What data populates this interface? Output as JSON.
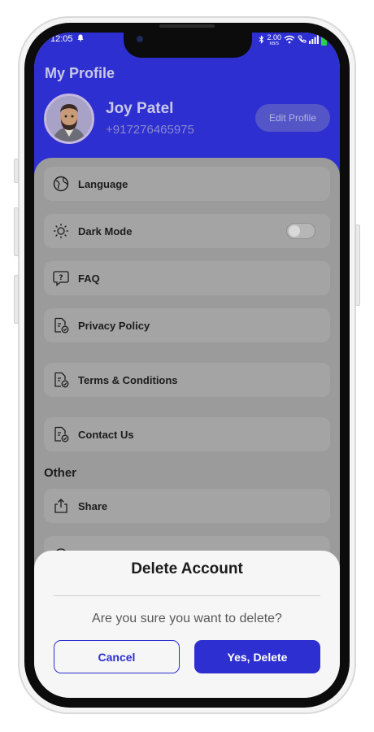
{
  "status_bar": {
    "time": "12:05",
    "net_speed": "2.00",
    "net_unit": "KB/S"
  },
  "header": {
    "title": "My Profile"
  },
  "profile": {
    "name": "Joy Patel",
    "phone": "+917276465975",
    "edit_label": "Edit Profile"
  },
  "menu": {
    "language": "Language",
    "dark_mode": "Dark Mode",
    "dark_mode_on": false,
    "faq": "FAQ",
    "privacy": "Privacy Policy",
    "terms": "Terms & Conditions",
    "contact": "Contact Us"
  },
  "other": {
    "label": "Other",
    "share": "Share"
  },
  "dialog": {
    "title": "Delete Account",
    "message": "Are you sure you want to delete?",
    "cancel_label": "Cancel",
    "confirm_label": "Yes, Delete"
  },
  "colors": {
    "accent": "#2e2fd0",
    "overlay_bg": "#9b9b9b",
    "dialog_bg": "#f6f6f6"
  }
}
